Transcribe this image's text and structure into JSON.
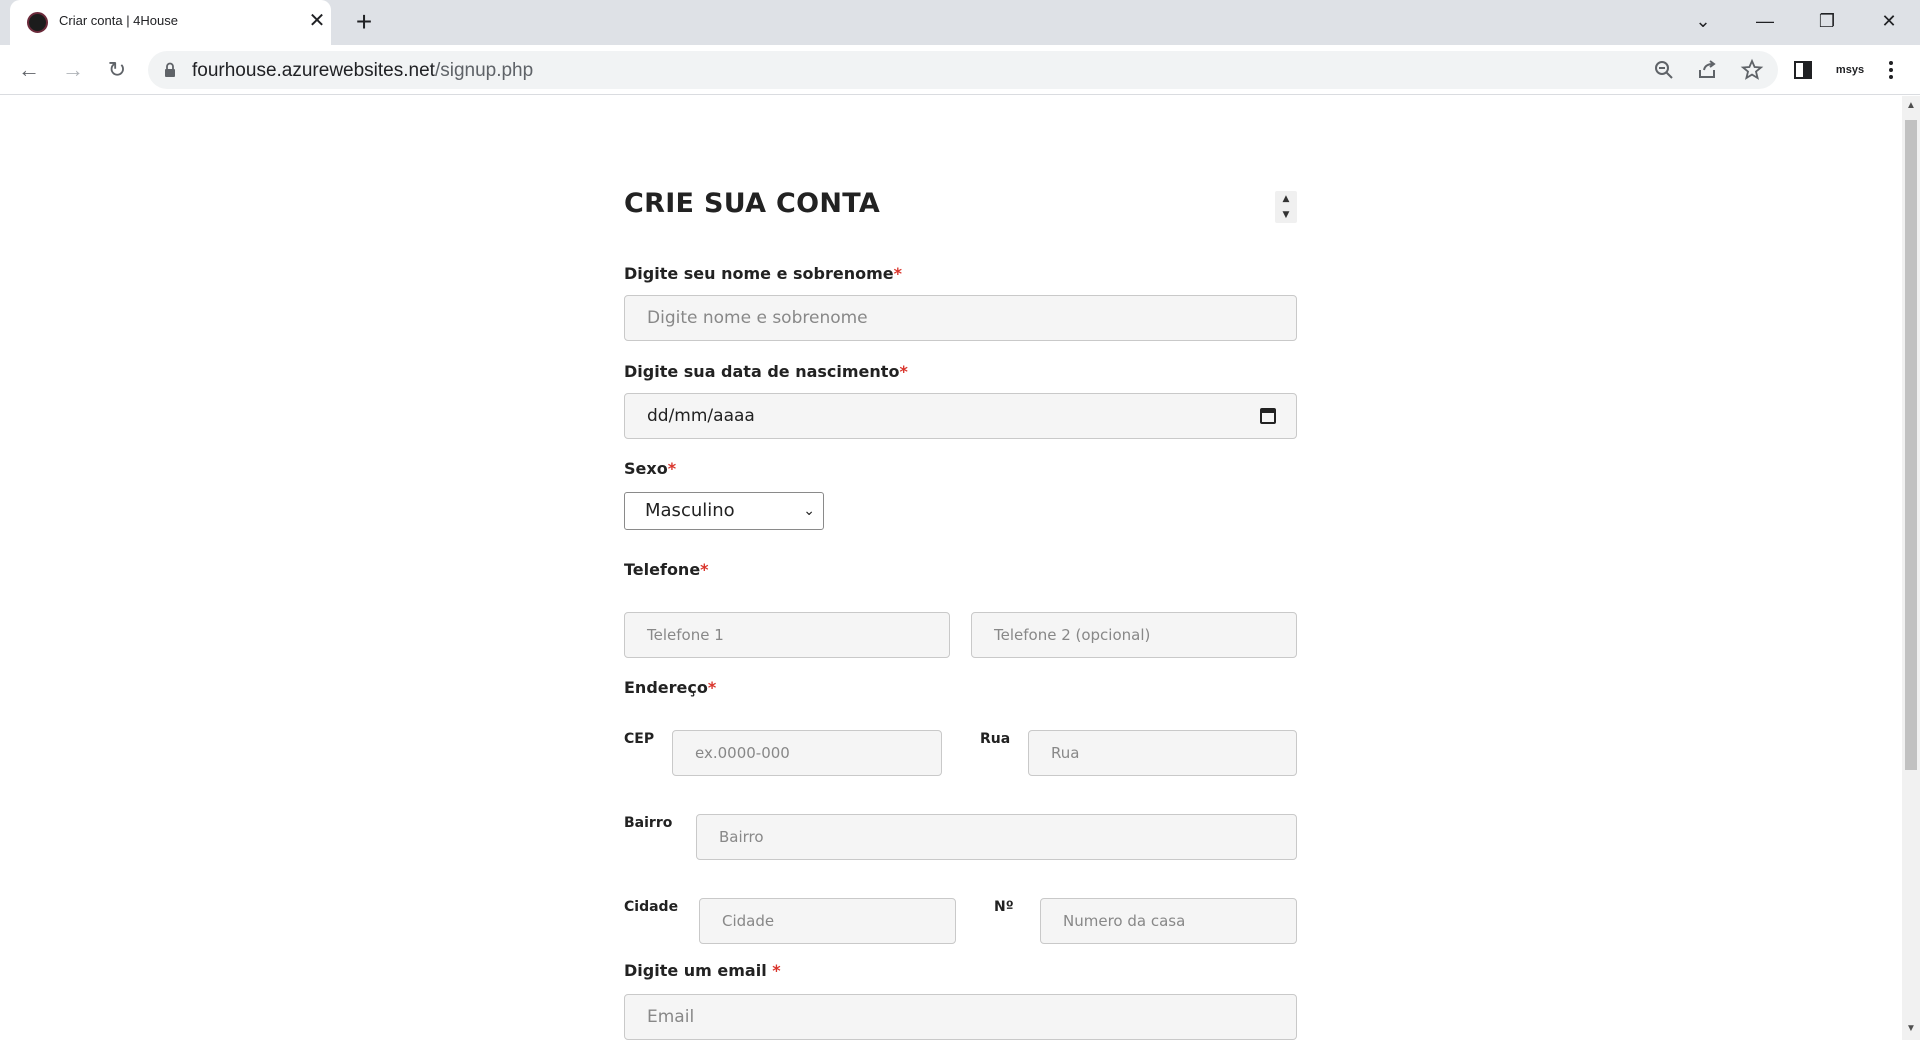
{
  "browser": {
    "tab_title": "Criar conta | 4House",
    "tab_close": "✕",
    "new_tab": "+",
    "url_domain": "fourhouse.azurewebsites.net",
    "url_path": "/signup.php",
    "profile_label": "msys",
    "window_controls": {
      "dropdown": "⌄",
      "minimize": "—",
      "restore": "❐",
      "close": "✕"
    },
    "nav": {
      "back": "←",
      "forward": "→",
      "reload": "↻"
    }
  },
  "form": {
    "title": "CRIE SUA CONTA",
    "name": {
      "label": "Digite seu nome e sobrenome",
      "required": "*",
      "placeholder": "Digite nome e sobrenome"
    },
    "birth": {
      "label": "Digite sua data de nascimento",
      "required": "*",
      "value": "dd/mm/aaaa"
    },
    "sex": {
      "label": "Sexo",
      "required": "*",
      "selected": "Masculino"
    },
    "phone": {
      "label": "Telefone",
      "required": "*",
      "placeholder1": "Telefone 1",
      "placeholder2": "Telefone 2 (opcional)"
    },
    "address": {
      "label": "Endereço",
      "required": "*",
      "cep_label": "CEP",
      "cep_placeholder": "ex.0000-000",
      "street_label": "Rua",
      "street_placeholder": "Rua",
      "district_label": "Bairro",
      "district_placeholder": "Bairro",
      "city_label": "Cidade",
      "city_placeholder": "Cidade",
      "number_label": "Nº",
      "number_placeholder": "Numero da casa"
    },
    "email": {
      "label": "Digite um email ",
      "required": "*",
      "placeholder": "Email"
    }
  }
}
